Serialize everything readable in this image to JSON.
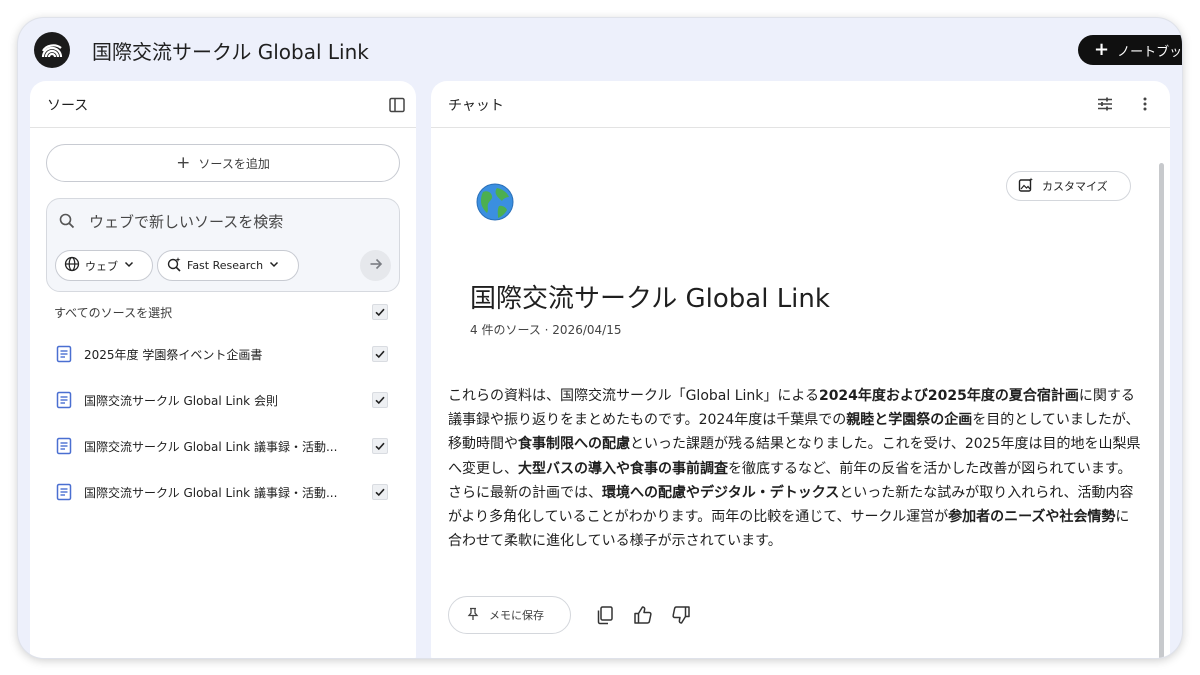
{
  "app": {
    "title": "国際交流サークル Global Link",
    "new_notebook_label": "ノートブッ"
  },
  "sources_panel": {
    "title": "ソース",
    "add_source_label": "ソースを追加",
    "search": {
      "placeholder": "ウェブで新しいソースを検索",
      "web_chip_label": "ウェブ",
      "research_chip_label": "Fast Research"
    },
    "select_all_label": "すべてのソースを選択",
    "items": [
      {
        "label": "2025年度 学園祭イベント企画書",
        "checked": true
      },
      {
        "label": "国際交流サークル Global Link 会則",
        "checked": true
      },
      {
        "label": "国際交流サークル Global Link 議事録・活動...",
        "checked": true
      },
      {
        "label": "国際交流サークル Global Link 議事録・活動...",
        "checked": true
      }
    ]
  },
  "chat_panel": {
    "title": "チャット",
    "customize_label": "カスタマイズ",
    "notebook_emoji": "globe-americas",
    "notebook_title": "国際交流サークル Global Link",
    "source_meta": "4 件のソース · 2026/04/15",
    "summary_segments": [
      {
        "text": "これらの資料は、国際交流サークル「Global Link」による",
        "bold": false
      },
      {
        "text": "2024年度および2025年度の夏合宿計画",
        "bold": true
      },
      {
        "text": "に関する議事録や振り返りをまとめたものです。2024年度は千葉県での",
        "bold": false
      },
      {
        "text": "親睦と学園祭の企画",
        "bold": true
      },
      {
        "text": "を目的としていましたが、移動時間や",
        "bold": false
      },
      {
        "text": "食事制限への配慮",
        "bold": true
      },
      {
        "text": "といった課題が残る結果となりました。これを受け、2025年度は目的地を山梨県へ変更し、",
        "bold": false
      },
      {
        "text": "大型バスの導入や食事の事前調査",
        "bold": true
      },
      {
        "text": "を徹底するなど、前年の反省を活かした改善が図られています。さらに最新の計画では、",
        "bold": false
      },
      {
        "text": "環境への配慮やデジタル・デトックス",
        "bold": true
      },
      {
        "text": "といった新たな試みが取り入れられ、活動内容がより多角化していることがわかります。両年の比較を通じて、サークル運営が",
        "bold": false
      },
      {
        "text": "参加者のニーズや社会情勢",
        "bold": true
      },
      {
        "text": "に合わせて柔軟に進化している様子が示されています。",
        "bold": false
      }
    ],
    "save_note_label": "メモに保存"
  },
  "colors": {
    "window_bg": "#edf0fb",
    "panel_bg": "#ffffff",
    "doc_icon": "#4a6fd1",
    "primary_button": "#101010"
  }
}
